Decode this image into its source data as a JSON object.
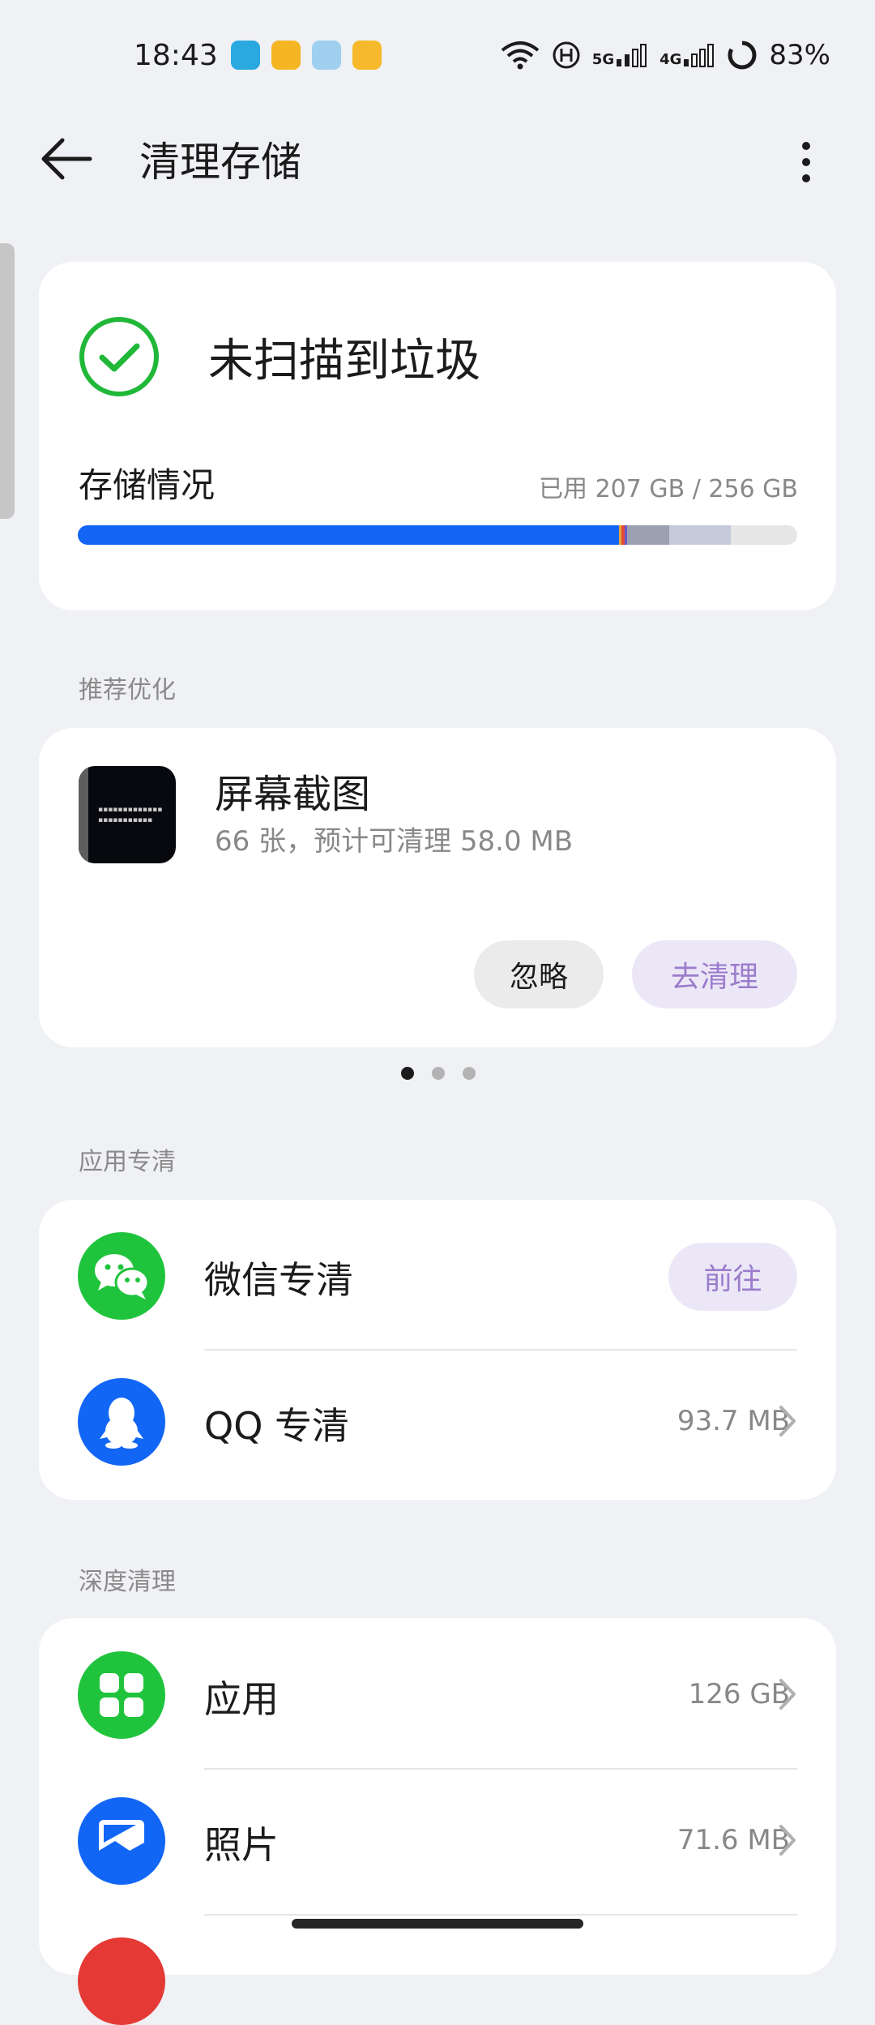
{
  "status_bar": {
    "time": "18:43",
    "network_5g": "5G",
    "network_4g": "4G",
    "battery": "83%",
    "notification_colors": [
      "#2aa9e0",
      "#f5b624",
      "#9fd0f0",
      "#f6b92b"
    ]
  },
  "header": {
    "title": "清理存储"
  },
  "summary": {
    "status": "未扫描到垃圾",
    "storage_label": "存储情况",
    "storage_used": "已用 207 GB / 256 GB",
    "used_fraction": 0.809,
    "bar_colors": [
      "#1265f5",
      "#e8a23a",
      "#e04a3a",
      "#6b56c9",
      "#9aa0b0",
      "#c6cad8"
    ]
  },
  "recommend": {
    "section_label": "推荐优化",
    "title": "屏幕截图",
    "subtitle": "66 张，预计可清理 58.0 MB",
    "ignore_label": "忽略",
    "clean_label": "去清理",
    "page_count": 3,
    "page_active": 0
  },
  "app_clean": {
    "section_label": "应用专清",
    "items": [
      {
        "label": "微信专清",
        "action": "前往",
        "icon": "wechat-icon",
        "color": "#20c43c"
      },
      {
        "label": "QQ 专清",
        "value": "93.7 MB",
        "icon": "qq-icon",
        "color": "#1166f6"
      }
    ]
  },
  "deep_clean": {
    "section_label": "深度清理",
    "items": [
      {
        "label": "应用",
        "value": "126 GB",
        "icon": "apps-icon",
        "color": "#20c43c"
      },
      {
        "label": "照片",
        "value": "71.6 MB",
        "icon": "photos-icon",
        "color": "#1166f6"
      }
    ]
  }
}
